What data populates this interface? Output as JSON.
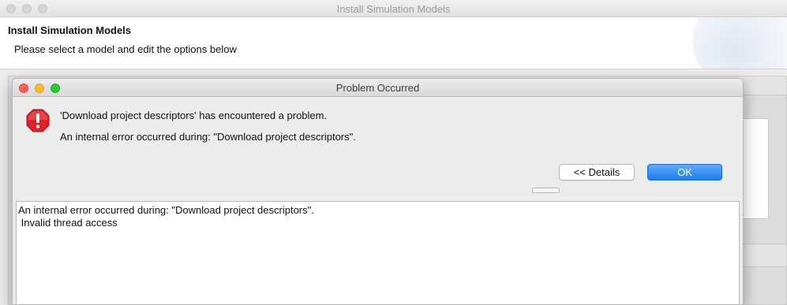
{
  "back_window": {
    "title": "Install Simulation Models",
    "header_title": "Install Simulation Models",
    "header_subtitle": "Please select a model and edit the options below"
  },
  "dialog": {
    "title": "Problem Occurred",
    "icon": "error-stop-icon",
    "message": "'Download project descriptors' has encountered a problem.",
    "detail_message": "An internal error occurred during: \"Download project descriptors\".",
    "details_button_label": "<< Details",
    "ok_button_label": "OK",
    "details_text": [
      "An internal error occurred during: \"Download project descriptors\".",
      " Invalid thread access"
    ]
  },
  "colors": {
    "ok_button": "#1e7df1",
    "error_icon": "#d9232a",
    "traffic_red": "#fc5f57",
    "traffic_yellow": "#fdbc2e",
    "traffic_green": "#28c840"
  }
}
